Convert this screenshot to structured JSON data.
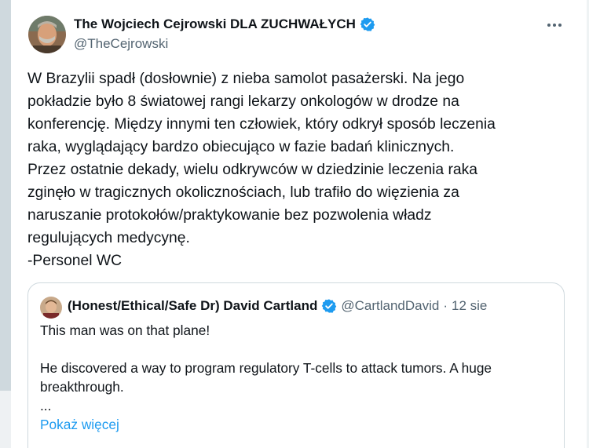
{
  "tweet": {
    "author_name": "The Wojciech Cejrowski DLA ZUCHWAŁYCH",
    "handle": "@TheCejrowski",
    "verified_icon": "verified-badge-icon",
    "more_icon": "more-options-icon",
    "lines": [
      "W Brazylii spadł (dosłownie) z nieba samolot pasażerski. Na jego",
      "pokładzie było 8 światowej rangi lekarzy onkologów w drodze na",
      "konferencję. Między innymi ten człowiek, który odkrył sposób leczenia",
      "raka, wyglądający bardzo obiecująco w fazie badań klinicznych.",
      "Przez ostatnie dekady, wielu odkrywców w dziedzinie leczenia raka",
      "zginęło w tragicznych okolicznościach, lub trafiło do więzienia za",
      "naruszanie protokołów/praktykowanie bez pozwolenia władz",
      "regulujących medycynę.",
      "-Personel WC"
    ]
  },
  "quote": {
    "author_name": "(Honest/Ethical/Safe Dr) David Cartland",
    "handle": "@CartlandDavid",
    "separator": "·",
    "date": "12 sie",
    "line1": "This man was on that plane!",
    "line2": "He discovered a way to program regulatory T-cells to attack tumors. A huge",
    "line3": "breakthrough.",
    "ellipsis": "...",
    "show_more": "Pokaż więcej"
  },
  "colors": {
    "verified": "#1d9bf0",
    "link": "#1d9bf0",
    "secondary_text": "#536471",
    "border": "#cfd9de"
  }
}
